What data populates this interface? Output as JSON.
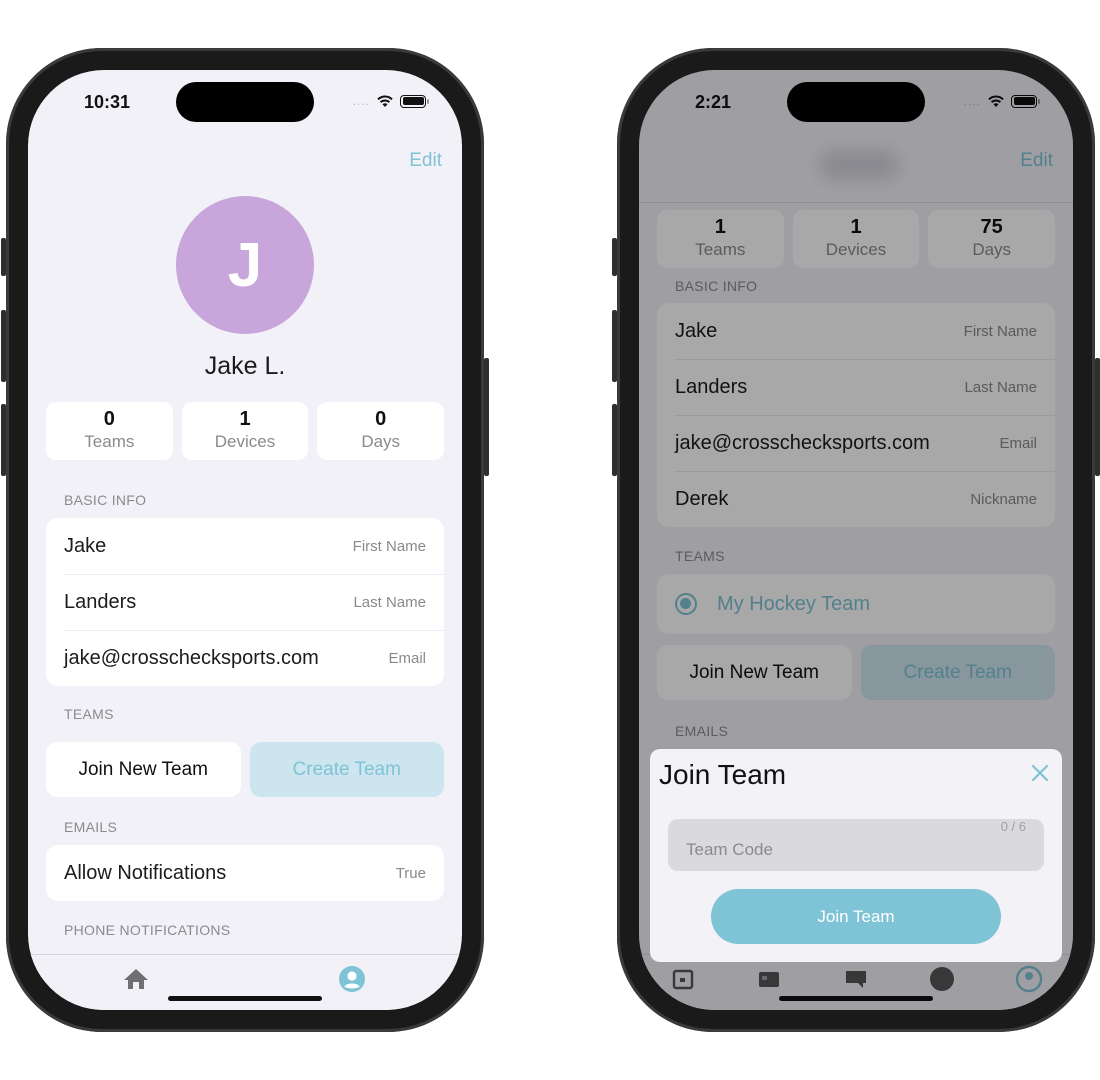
{
  "colors": {
    "accent": "#7ec3d6",
    "avatar_bg": "#c8a5da",
    "create_button_bg": "#cde5ef",
    "screen_bg": "#f2f1f7"
  },
  "left_phone": {
    "status_bar": {
      "time": "10:31",
      "signal": "....",
      "wifi_icon": "wifi-icon",
      "battery_icon": "battery-icon"
    },
    "nav": {
      "edit_label": "Edit"
    },
    "profile": {
      "avatar_initial": "J",
      "display_name": "Jake L."
    },
    "stats": [
      {
        "value": "0",
        "label": "Teams"
      },
      {
        "value": "1",
        "label": "Devices"
      },
      {
        "value": "0",
        "label": "Days"
      }
    ],
    "basic_info": {
      "header": "BASIC INFO",
      "rows": [
        {
          "value": "Jake",
          "label": "First Name"
        },
        {
          "value": "Landers",
          "label": "Last Name"
        },
        {
          "value": "jake@crosschecksports.com",
          "label": "Email"
        }
      ]
    },
    "teams": {
      "header": "TEAMS",
      "join_label": "Join New Team",
      "create_label": "Create Team"
    },
    "emails": {
      "header": "EMAILS",
      "rows": [
        {
          "value": "Allow Notifications",
          "label": "True"
        }
      ]
    },
    "phone_notifications": {
      "header": "PHONE NOTIFICATIONS"
    },
    "tab_bar": [
      {
        "icon": "home-icon",
        "active": false
      },
      {
        "icon": "profile-icon",
        "active": true
      }
    ]
  },
  "right_phone": {
    "status_bar": {
      "time": "2:21",
      "signal": "....",
      "wifi_icon": "wifi-icon",
      "battery_icon": "battery-icon"
    },
    "nav": {
      "edit_label": "Edit"
    },
    "stats": [
      {
        "value": "1",
        "label": "Teams"
      },
      {
        "value": "1",
        "label": "Devices"
      },
      {
        "value": "75",
        "label": "Days"
      }
    ],
    "basic_info": {
      "header": "BASIC INFO",
      "rows": [
        {
          "value": "Jake",
          "label": "First Name"
        },
        {
          "value": "Landers",
          "label": "Last Name"
        },
        {
          "value": "jake@crosschecksports.com",
          "label": "Email"
        },
        {
          "value": "Derek",
          "label": "Nickname"
        }
      ]
    },
    "teams": {
      "header": "TEAMS",
      "items": [
        {
          "name": "My Hockey Team",
          "selected": true
        }
      ],
      "join_label": "Join New Team",
      "create_label": "Create Team"
    },
    "emails": {
      "header": "EMAILS"
    },
    "tab_bar": [
      {
        "icon": "calendar-icon"
      },
      {
        "icon": "roster-icon"
      },
      {
        "icon": "chat-icon"
      },
      {
        "icon": "team-icon"
      },
      {
        "icon": "profile-icon",
        "active": true
      }
    ],
    "join_sheet": {
      "title": "Join Team",
      "close_icon": "close-icon",
      "input_value": "",
      "input_placeholder": "Team Code",
      "char_count": "0 / 6",
      "submit_label": "Join Team"
    }
  }
}
